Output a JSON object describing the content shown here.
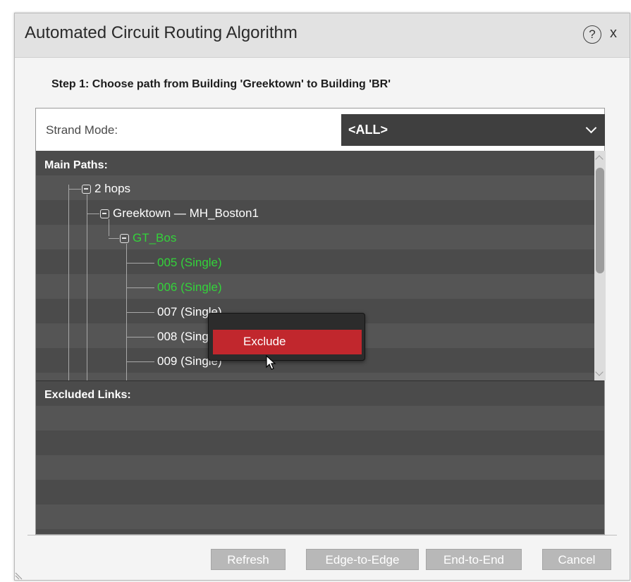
{
  "dialog": {
    "title": "Automated Circuit Routing Algorithm",
    "help_icon_glyph": "?",
    "close_glyph": "x"
  },
  "step": {
    "text": "Step 1: Choose path from Building 'Greektown' to Building 'BR'"
  },
  "strand_mode": {
    "label": "Strand Mode:",
    "value": "<ALL>"
  },
  "main_paths": {
    "title": "Main Paths:",
    "hops": "2 hops",
    "route": "Greektown — MH_Boston1",
    "segment": "GT_Bos",
    "strands": [
      "005 (Single)",
      "006 (Single)",
      "007 (Single)",
      "008 (Single)",
      "009 (Single)"
    ]
  },
  "context_menu": {
    "exclude_label": "Exclude"
  },
  "excluded_links": {
    "title": "Excluded Links:"
  },
  "buttons": {
    "refresh": "Refresh",
    "edge_to_edge": "Edge-to-Edge",
    "end_to_end": "End-to-End",
    "cancel": "Cancel"
  },
  "colors": {
    "accent_red": "#c1272d",
    "highlight_green": "#33d33a",
    "select_bg": "#3f3f3f"
  }
}
